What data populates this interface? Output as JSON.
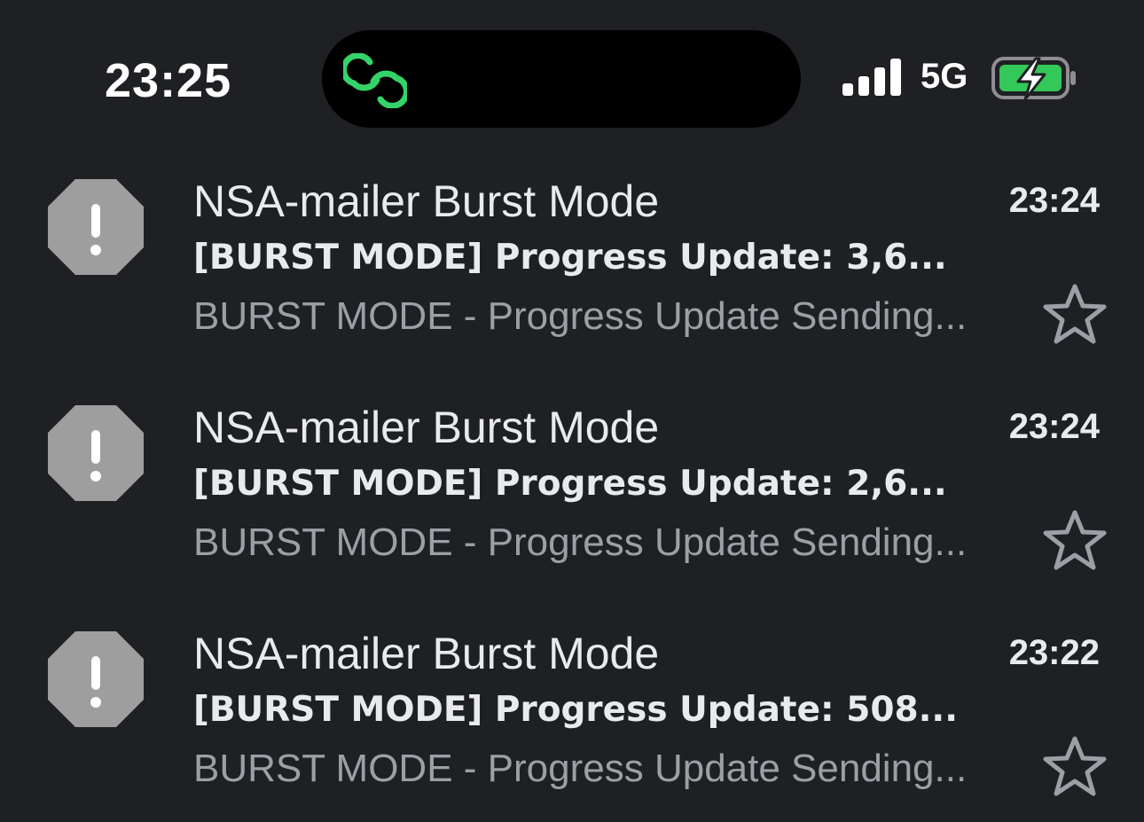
{
  "status_bar": {
    "time": "23:25",
    "network": "5G",
    "island_icon": "link-rings-icon",
    "signal_icon": "cellular-signal-icon",
    "battery_icon": "battery-charging-icon",
    "battery_color": "#34c759"
  },
  "colors": {
    "background": "#1f2023",
    "text_primary": "#e8eaed",
    "text_secondary": "#9aa0a6",
    "avatar": "#9e9e9e"
  },
  "mails": [
    {
      "sender": "NSA-mailer Burst Mode",
      "time": "23:24",
      "subject": "[BURST MODE] Progress Update: 3,6...",
      "snippet": "BURST MODE - Progress Update Sending...",
      "avatar_icon": "alert-octagon-icon",
      "star_icon": "star-outline-icon"
    },
    {
      "sender": "NSA-mailer Burst Mode",
      "time": "23:24",
      "subject": "[BURST MODE] Progress Update: 2,6...",
      "snippet": "BURST MODE - Progress Update Sending...",
      "avatar_icon": "alert-octagon-icon",
      "star_icon": "star-outline-icon"
    },
    {
      "sender": "NSA-mailer Burst Mode",
      "time": "23:22",
      "subject": "[BURST MODE] Progress Update: 508...",
      "snippet": "BURST MODE - Progress Update Sending...",
      "avatar_icon": "alert-octagon-icon",
      "star_icon": "star-outline-icon"
    }
  ]
}
